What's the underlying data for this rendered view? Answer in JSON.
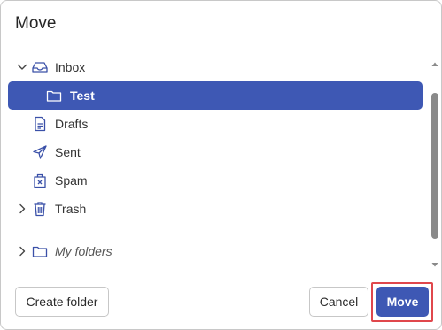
{
  "dialog": {
    "title": "Move"
  },
  "tree": {
    "items": [
      {
        "label": "Inbox",
        "icon": "inbox-icon",
        "expanded": true
      },
      {
        "label": "Test",
        "icon": "folder-icon",
        "selected": true
      },
      {
        "label": "Drafts",
        "icon": "draft-document-icon"
      },
      {
        "label": "Sent",
        "icon": "paper-plane-icon"
      },
      {
        "label": "Spam",
        "icon": "spam-box-icon"
      },
      {
        "label": "Trash",
        "icon": "trash-icon",
        "expanded": false
      },
      {
        "label": "My folders",
        "icon": "folder-icon",
        "expanded": false
      }
    ]
  },
  "footer": {
    "create_folder_label": "Create folder",
    "cancel_label": "Cancel",
    "move_label": "Move"
  },
  "colors": {
    "accent": "#3e58b4",
    "highlight": "#e0474c"
  }
}
